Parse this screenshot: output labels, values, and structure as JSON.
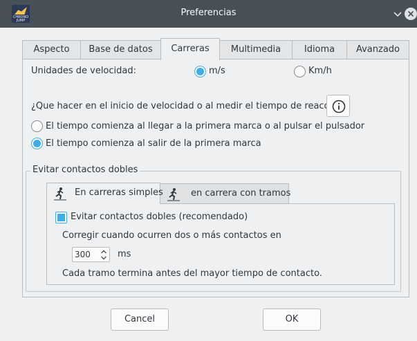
{
  "window": {
    "title": "Preferencias",
    "logo_text": "CHRONO JUMP",
    "icons": [
      "app-logo-icon",
      "chevron-down-icon",
      "close-icon"
    ]
  },
  "tabs": [
    "Aspecto",
    "Base de datos",
    "Carreras",
    "Multimedia",
    "Idioma",
    "Avanzado"
  ],
  "active_tab": "Carreras",
  "speed": {
    "label": "Unidades de velocidad:",
    "option_ms": "m/s",
    "option_kmh": "Km/h",
    "selected": "m/s"
  },
  "reaction": {
    "question": "¿Que hacer en el inicio de velocidad o al medir el tiempo de reacción?",
    "option_first": "El tiempo comienza al llegar a la primera marca o al pulsar el pulsador",
    "option_second": "El tiempo comienza al salir de la primera marca",
    "selected": "second"
  },
  "double_contacts": {
    "group_title": "Evitar contactos dobles",
    "subtabs": [
      "En carreras simples",
      "en carrera con tramos"
    ],
    "active_subtab": "En carreras simples",
    "checkbox_label": "Evitar contactos dobles (recomendado)",
    "checkbox_checked": true,
    "correct_label": "Corregir cuando ocurren dos o más contactos en",
    "spin_value": "300",
    "spin_unit": "ms",
    "note": "Cada tramo termina antes del mayor tiempo de contacto."
  },
  "buttons": {
    "cancel": "Cancel",
    "ok": "OK"
  },
  "colors": {
    "accent": "#3daee9",
    "titlebar": "#475057",
    "background": "#eff0f1"
  }
}
